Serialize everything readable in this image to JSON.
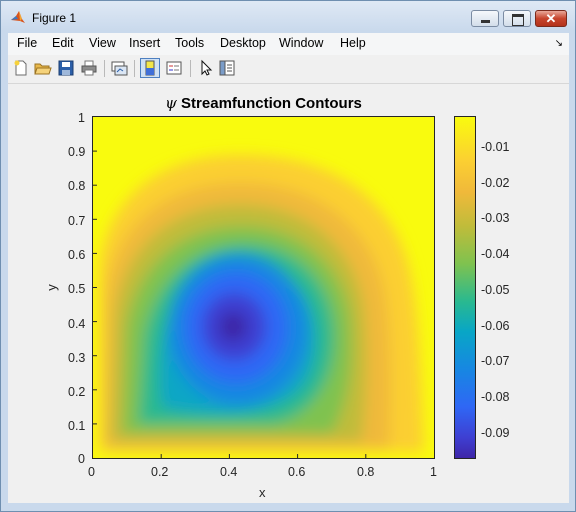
{
  "window": {
    "title": "Figure 1"
  },
  "menu": [
    "File",
    "Edit",
    "View",
    "Insert",
    "Tools",
    "Desktop",
    "Window",
    "Help"
  ],
  "toolbar_icons": [
    "new-figure-icon",
    "open-file-icon",
    "save-icon",
    "print-icon",
    "link-plot-icon",
    "colorbar-toggle-icon",
    "legend-toggle-icon",
    "edit-plot-arrow-icon",
    "property-inspector-icon"
  ],
  "chart_data": {
    "type": "heatmap",
    "title_symbol": "ψ",
    "title": "Streamfunction Contours",
    "xlabel": "x",
    "ylabel": "y",
    "xlim": [
      0,
      1
    ],
    "ylim": [
      0,
      1
    ],
    "xticks": [
      "0",
      "0.2",
      "0.4",
      "0.6",
      "0.8",
      "1"
    ],
    "yticks": [
      "0",
      "0.1",
      "0.2",
      "0.3",
      "0.4",
      "0.5",
      "0.6",
      "0.7",
      "0.8",
      "0.9",
      "1"
    ],
    "colormap": "parula",
    "vortex_center": {
      "x": 0.41,
      "y": 0.38
    },
    "minimum_value": -0.097,
    "maximum_value": 0,
    "colorbar": {
      "ticks": [
        "-0.01",
        "-0.02",
        "-0.03",
        "-0.04",
        "-0.05",
        "-0.06",
        "-0.07",
        "-0.08",
        "-0.09"
      ],
      "range": [
        -0.097,
        -0.001
      ]
    }
  }
}
